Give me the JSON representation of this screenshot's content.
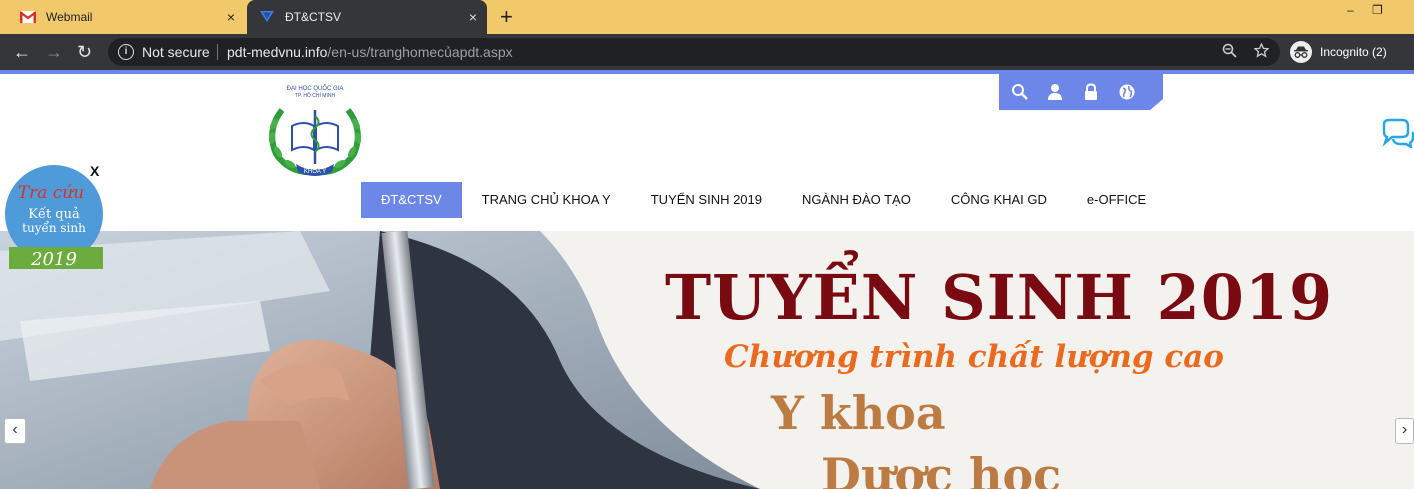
{
  "browser": {
    "tabs": [
      {
        "label": "Webmail",
        "icon": "gmail-icon",
        "active": false
      },
      {
        "label": "ĐT&CTSV",
        "icon": "site-favicon",
        "active": true
      }
    ],
    "close_glyph": "×",
    "new_tab_glyph": "+",
    "window_controls": {
      "minimize": "–",
      "restore": "❐"
    },
    "nav": {
      "back": "←",
      "forward": "→",
      "reload": "↻"
    },
    "security_status": "Not secure",
    "url_host": "pdt-medvnu.info",
    "url_path": "/en-us/tranghomecủapdt.aspx",
    "incognito_label": "Incognito (2)",
    "colors": {
      "tabstrip": "#f2c96a",
      "toolbar": "#35363a",
      "accent": "#6d87e8"
    }
  },
  "header": {
    "logo_alt": "Khoa Y logo",
    "utility_icons": [
      "search-icon",
      "user-icon",
      "lock-icon",
      "globe-icon"
    ],
    "chat_icon": "chat-icon"
  },
  "menu": {
    "items": [
      {
        "label": "ĐT&CTSV",
        "active": true
      },
      {
        "label": "TRANG CHỦ KHOA Y",
        "active": false
      },
      {
        "label": "TUYỂN SINH 2019",
        "active": false
      },
      {
        "label": "NGÀNH ĐÀO TẠO",
        "active": false
      },
      {
        "label": "CÔNG KHAI GD",
        "active": false
      },
      {
        "label": "e-OFFICE",
        "active": false
      }
    ]
  },
  "badge": {
    "close_label": "X",
    "line1": "Tra cứu",
    "line2": "Kết quả",
    "line3": "tuyển sinh",
    "year": "2019"
  },
  "hero": {
    "title": "TUYỂN SINH 2019",
    "subtitle": "Chương trình chất lượng cao",
    "program1": "Y khoa",
    "program2": "Dược học",
    "prev_glyph": "‹",
    "next_glyph": "›"
  }
}
